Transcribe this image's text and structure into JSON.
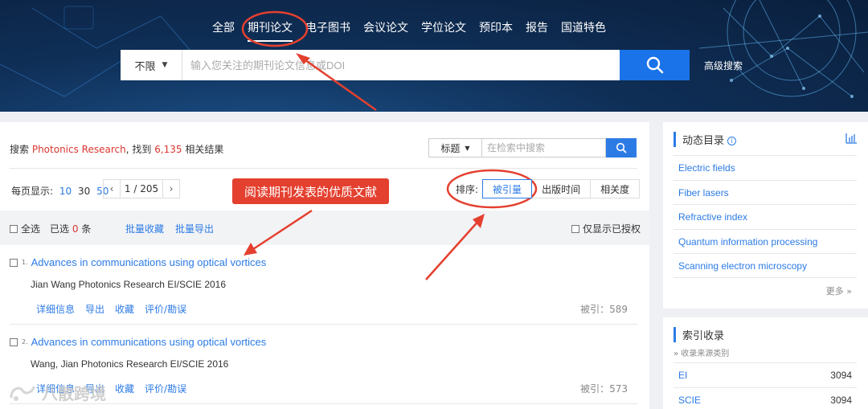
{
  "nav": [
    "全部",
    "期刊论文",
    "电子图书",
    "会议论文",
    "学位论文",
    "预印本",
    "报告",
    "国道特色"
  ],
  "search": {
    "scope": "不限",
    "placeholder": "输入您关注的期刊论文信息或DOI",
    "advanced": "高级搜索"
  },
  "summary": {
    "prefix": "搜索",
    "query": "Photonics Research",
    "middle": ", 找到",
    "count": "6,135",
    "suffix": "相关结果"
  },
  "inner_search": {
    "field": "标题",
    "placeholder": "在检索中搜索"
  },
  "perpage": {
    "label": "每页显示:",
    "options": [
      "10",
      "30",
      "50"
    ]
  },
  "pager": {
    "prev": "‹",
    "page": "1 / 205",
    "next": "›"
  },
  "sort": {
    "label": "排序:",
    "options": [
      "被引量",
      "出版时间",
      "相关度"
    ]
  },
  "bulk": {
    "select_all": "全选",
    "selected_prefix": "已选",
    "selected_count": "0",
    "selected_suffix": "条",
    "bulk_collect": "批量收藏",
    "bulk_export": "批量导出",
    "only_authorized": "仅显示已授权"
  },
  "results": [
    {
      "index": "1.",
      "title": "Advances in communications using optical vortices",
      "meta": "Jian Wang Photonics Research EI/SCIE 2016",
      "actions": [
        "详细信息",
        "导出",
        "收藏",
        "评价/勘误"
      ],
      "cite": "被引：589"
    },
    {
      "index": "2.",
      "title": "Advances in communications using optical vortices",
      "meta": "Wang, Jian Photonics Research EI/SCIE 2016",
      "actions": [
        "详细信息",
        "导出",
        "收藏",
        "评价/勘误"
      ],
      "cite": "被引：573"
    }
  ],
  "sidebar": {
    "dynamic_title": "动态目录",
    "topics": [
      "Electric fields",
      "Fiber lasers",
      "Refractive index",
      "Quantum information processing",
      "Scanning electron microscopy"
    ],
    "more": "更多 »",
    "index_title": "索引收录",
    "index_sub": "» 收录来源类别",
    "index_rows": [
      {
        "name": "EI",
        "count": "3094"
      },
      {
        "name": "SCIE",
        "count": "3094"
      }
    ]
  },
  "callout": "阅读期刊发表的优质文献",
  "watermark": "八散跨境",
  "colors": {
    "accent": "#2c7be5",
    "highlight": "#d9362f",
    "annotation": "#e4402f",
    "banner": "#0f2f57"
  }
}
